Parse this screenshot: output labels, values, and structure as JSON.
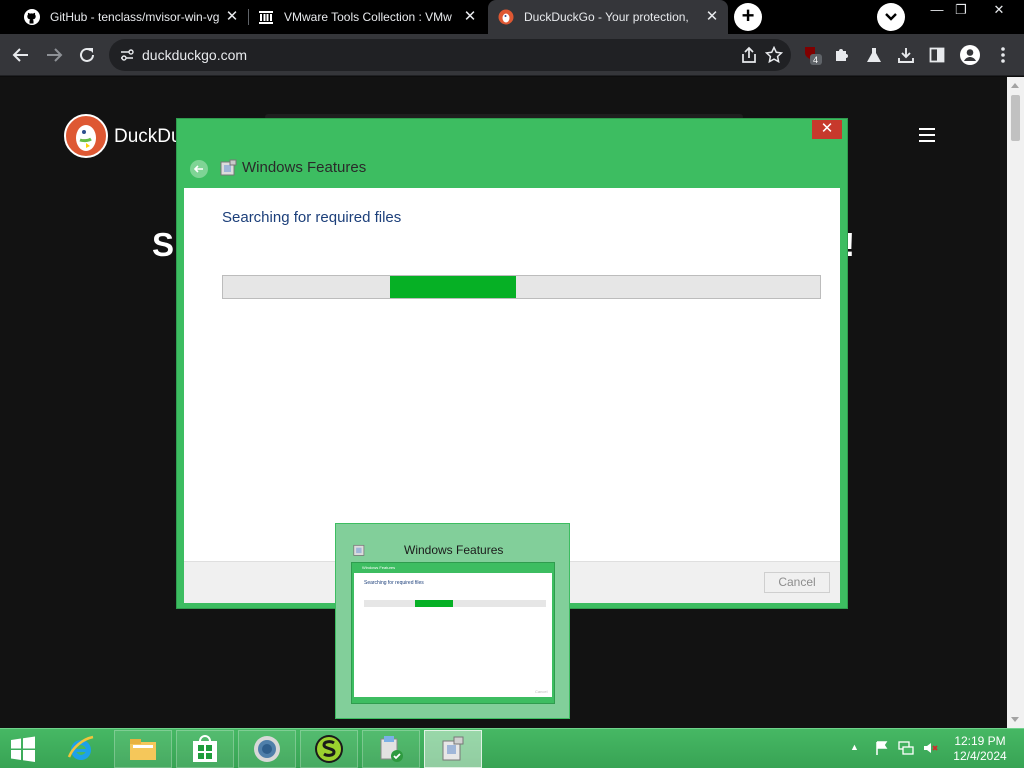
{
  "browser": {
    "tabs": [
      {
        "title": "GitHub - tenclass/mvisor-win-vg",
        "icon": "github-icon",
        "active": false
      },
      {
        "title": "VMware Tools Collection : VMw",
        "icon": "archive-org-icon",
        "active": false
      },
      {
        "title": "DuckDuckGo - Your protection, ",
        "icon": "duckduckgo-icon",
        "active": true
      }
    ],
    "new_tab_label": "+",
    "url": "duckduckgo.com",
    "extension_badge": "4"
  },
  "page": {
    "brand": "DuckDu",
    "headline_start": "S",
    "headline_end": "!"
  },
  "dialog": {
    "title": "Windows Features",
    "status_text": "Searching for required files",
    "progress_fraction": 0.21,
    "progress_offset": 0.28,
    "cancel_label": "Cancel",
    "close_glyph": "✕"
  },
  "thumbnail": {
    "title": "Windows Features",
    "inner_title": "Windows Features",
    "inner_text": "Searching for required files",
    "inner_cancel": "Cancel"
  },
  "taskbar": {
    "items": [
      "internet-explorer-icon",
      "file-explorer-icon",
      "store-icon",
      "chrome-icon",
      "s-app-icon",
      "installer-icon",
      "windows-features-icon"
    ],
    "clock_time": "12:19 PM",
    "clock_date": "12/4/2024"
  },
  "colors": {
    "accent_green": "#3dbd61",
    "progress_green": "#06b025",
    "ddg_orange": "#de5833",
    "close_red": "#c7392c"
  }
}
